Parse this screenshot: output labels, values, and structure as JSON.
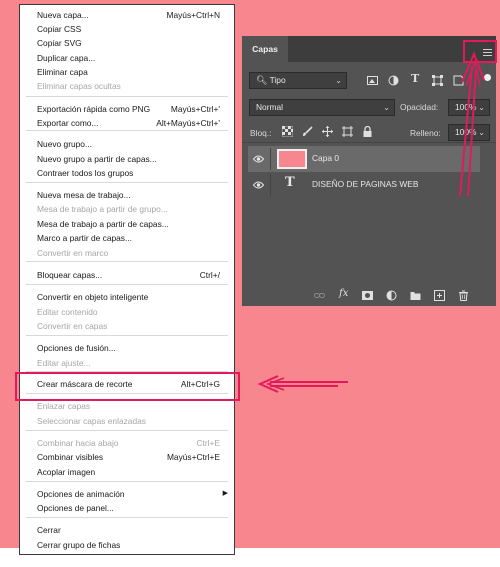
{
  "colors": {
    "background": "#f7868f",
    "highlight": "#e3195b",
    "panel": "#535353",
    "thumb": "#f7868f"
  },
  "context_menu": {
    "items": [
      {
        "label": "Nueva capa...",
        "shortcut": "Mayús+Ctrl+N",
        "disabled": false
      },
      {
        "label": "Copiar CSS",
        "shortcut": "",
        "disabled": false
      },
      {
        "label": "Copiar SVG",
        "shortcut": "",
        "disabled": false
      },
      {
        "label": "Duplicar capa...",
        "shortcut": "",
        "disabled": false
      },
      {
        "label": "Eliminar capa",
        "shortcut": "",
        "disabled": false
      },
      {
        "label": "Eliminar capas ocultas",
        "shortcut": "",
        "disabled": true
      },
      {
        "label": "Exportación rápida como PNG",
        "shortcut": "Mayús+Ctrl+'",
        "disabled": false
      },
      {
        "label": "Exportar como...",
        "shortcut": "Alt+Mayús+Ctrl+'",
        "disabled": false
      },
      {
        "label": "Nuevo grupo...",
        "shortcut": "",
        "disabled": false
      },
      {
        "label": "Nuevo grupo a partir de capas...",
        "shortcut": "",
        "disabled": false
      },
      {
        "label": "Contraer todos los grupos",
        "shortcut": "",
        "disabled": false
      },
      {
        "label": "Nueva mesa de trabajo...",
        "shortcut": "",
        "disabled": false
      },
      {
        "label": "Mesa de trabajo a partir de grupo...",
        "shortcut": "",
        "disabled": true
      },
      {
        "label": "Mesa de trabajo a partir de capas...",
        "shortcut": "",
        "disabled": false
      },
      {
        "label": "Marco a partir de capas...",
        "shortcut": "",
        "disabled": false
      },
      {
        "label": "Convertir en marco",
        "shortcut": "",
        "disabled": true
      },
      {
        "label": "Bloquear capas...",
        "shortcut": "Ctrl+/",
        "disabled": false
      },
      {
        "label": "Convertir en objeto inteligente",
        "shortcut": "",
        "disabled": false
      },
      {
        "label": "Editar contenido",
        "shortcut": "",
        "disabled": true
      },
      {
        "label": "Convertir en capas",
        "shortcut": "",
        "disabled": true
      },
      {
        "label": "Opciones de fusión...",
        "shortcut": "",
        "disabled": false
      },
      {
        "label": "Editar ajuste...",
        "shortcut": "",
        "disabled": true
      },
      {
        "label": "Crear máscara de recorte",
        "shortcut": "Alt+Ctrl+G",
        "disabled": false
      },
      {
        "label": "Enlazar capas",
        "shortcut": "",
        "disabled": true
      },
      {
        "label": "Seleccionar capas enlazadas",
        "shortcut": "",
        "disabled": true
      },
      {
        "label": "Combinar hacia abajo",
        "shortcut": "Ctrl+E",
        "disabled": true
      },
      {
        "label": "Combinar visibles",
        "shortcut": "Mayús+Ctrl+E",
        "disabled": false
      },
      {
        "label": "Acoplar imagen",
        "shortcut": "",
        "disabled": false
      },
      {
        "label": "Opciones de animación",
        "shortcut": "",
        "disabled": false,
        "submenu": true
      },
      {
        "label": "Opciones de panel...",
        "shortcut": "",
        "disabled": false
      },
      {
        "label": "Cerrar",
        "shortcut": "",
        "disabled": false
      },
      {
        "label": "Cerrar grupo de fichas",
        "shortcut": "",
        "disabled": false
      }
    ]
  },
  "layers_panel": {
    "tab": "Capas",
    "filter_kind": "Tipo",
    "blend_mode": "Normal",
    "opacity_label": "Opacidad:",
    "opacity_value": "100%",
    "lock_label": "Bloq.:",
    "fill_label": "Relleno:",
    "fill_value": "100%",
    "layers": [
      {
        "name": "Capa 0",
        "type": "pixel",
        "selected": true
      },
      {
        "name": "DISEÑO DE PAGINAS WEB",
        "type": "text",
        "selected": false
      }
    ],
    "type_glyph": "T",
    "fx_label": "fx"
  }
}
